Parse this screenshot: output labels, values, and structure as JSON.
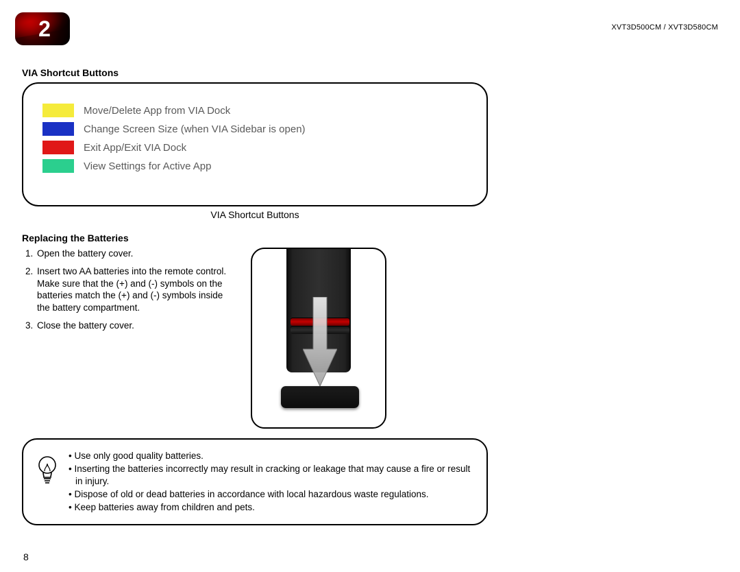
{
  "chapter": "2",
  "model_code": "XVT3D500CM / XVT3D580CM",
  "via": {
    "title": "VIA Shortcut Buttons",
    "rows": [
      {
        "color": "#f5eb3b",
        "label": "Move/Delete App from VIA Dock"
      },
      {
        "color": "#1a31c4",
        "label": "Change Screen Size (when VIA Sidebar is open)"
      },
      {
        "color": "#e01818",
        "label": "Exit App/Exit VIA Dock"
      },
      {
        "color": "#2bcf8e",
        "label": "View Settings for Active App"
      }
    ],
    "caption": "VIA Shortcut Buttons"
  },
  "batteries": {
    "title": "Replacing the Batteries",
    "steps": [
      "Open the battery cover.",
      "Insert two AA batteries into the remote control. Make sure that the (+) and (-) symbols on the batteries match the (+) and (-) symbols inside the battery compartment.",
      "Close the battery cover."
    ]
  },
  "warnings": [
    "Use only good quality batteries.",
    "Inserting the batteries incorrectly may result in cracking or leakage that may cause a fire or result in injury.",
    "Dispose of old or dead batteries in accordance with local hazardous waste regulations.",
    "Keep batteries away from children and pets."
  ],
  "page_number": "8"
}
